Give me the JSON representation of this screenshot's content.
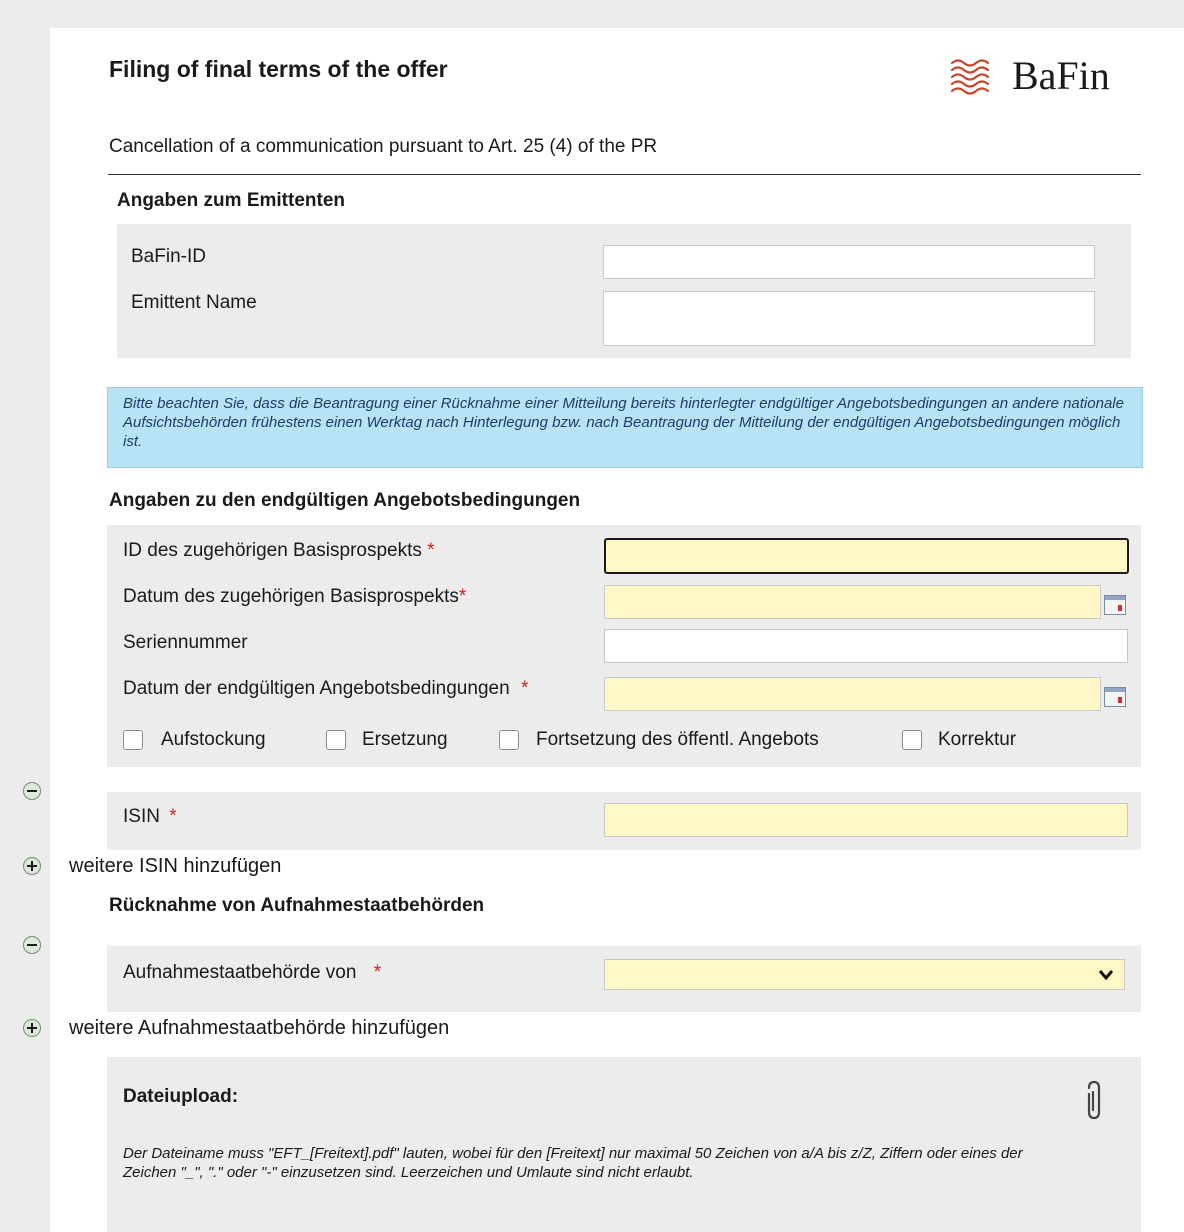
{
  "header": {
    "title": "Filing of final terms of the offer",
    "logo_text": "BaFin",
    "subtitle": "Cancellation of a communication pursuant to Art. 25 (4) of the PR"
  },
  "issuer": {
    "heading": "Angaben zum Emittenten",
    "bafin_id_label": "BaFin-ID",
    "bafin_id_value": "",
    "name_label": "Emittent Name",
    "name_value": ""
  },
  "notice": "Bitte beachten Sie, dass die Beantragung einer Rücknahme einer Mitteilung bereits hinterlegter endgültiger Angebotsbedingungen an andere nationale Aufsichtsbehörden frühestens einen Werktag nach Hinterlegung bzw. nach Beantragung der Mitteilung der endgültigen Angebotsbedingungen möglich ist.",
  "final_terms": {
    "heading": "Angaben zu den endgültigen Angebotsbedingungen",
    "prospectus_id_label": "ID des zugehörigen Basisprospekts",
    "prospectus_date_label": "Datum des zugehörigen Basisprospekts",
    "series_label": "Seriennummer",
    "terms_date_label": "Datum der endgültigen Angebotsbedingungen",
    "required_mark": "*",
    "checkboxes": [
      {
        "label": "Aufstockung",
        "checked": false
      },
      {
        "label": "Ersetzung",
        "checked": false
      },
      {
        "label": "Fortsetzung des öffentl. Angebots",
        "checked": false
      },
      {
        "label": "Korrektur",
        "checked": false
      }
    ]
  },
  "isin": {
    "label": "ISIN",
    "value": "",
    "add_label": "weitere ISIN hinzufügen"
  },
  "withdrawal": {
    "heading": "Rücknahme von Aufnahmestaatbehörden",
    "authority_label": "Aufnahmestaatbehörde von",
    "authority_selected": "",
    "add_label": "weitere Aufnahmestaatbehörde hinzufügen"
  },
  "upload": {
    "heading": "Dateiupload:",
    "text": "Der Dateiname muss \"EFT_[Freitext].pdf\" lauten, wobei für den [Freitext] nur maximal 50 Zeichen von a/A bis z/Z, Ziffern oder eines der Zeichen \"_\", \".\" oder \"-\"  einzusetzen sind. Leerzeichen und Umlaute sind nicht erlaubt."
  },
  "colors": {
    "required": "#cc2222",
    "required_field_bg": "#fff8c6",
    "notice_bg": "#b7e3f4",
    "panel_bg": "#ececec",
    "logo_wave": "#c8452a"
  }
}
